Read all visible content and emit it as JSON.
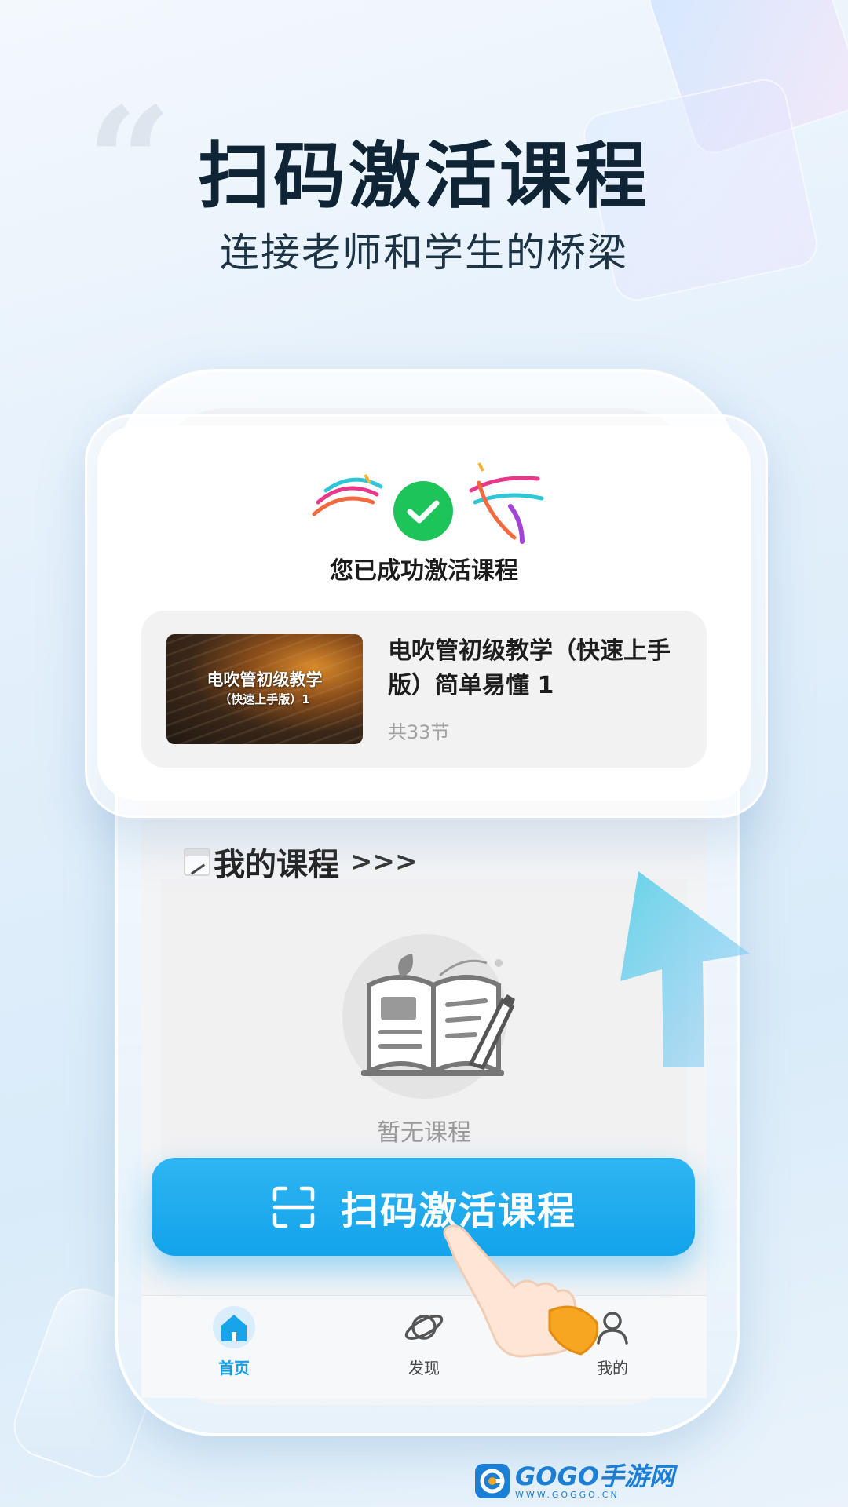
{
  "hero": {
    "quote_mark": "“",
    "title": "扫码激活课程",
    "subtitle": "连接老师和学生的桥梁"
  },
  "popup": {
    "success_icon": "check-circle-icon",
    "success_text": "您已成功激活课程",
    "course": {
      "thumbnail_title": "电吹管初级教学",
      "thumbnail_subtitle": "（快速上手版）1",
      "name": "电吹管初级教学（快速上手版）简单易懂 1",
      "lesson_count": "共33节"
    }
  },
  "my_courses": {
    "icon": "calendar-icon",
    "title": "我的课程",
    "more": ">>>",
    "empty_icon": "open-book-icon",
    "empty_text": "暂无课程"
  },
  "scan_button": {
    "icon": "scan-icon",
    "label": "扫码激活课程"
  },
  "bottom_nav": {
    "items": [
      {
        "label": "首页",
        "icon": "home-icon",
        "active": true
      },
      {
        "label": "发现",
        "icon": "planet-icon",
        "active": false
      },
      {
        "label": "我的",
        "icon": "user-icon",
        "active": false
      }
    ]
  },
  "watermark": {
    "brand": "GOGO手游网",
    "url": "WWW.GOGGO.CN"
  },
  "colors": {
    "accent": "#12a3ea",
    "success": "#1cc45a",
    "headline": "#0f2536"
  }
}
